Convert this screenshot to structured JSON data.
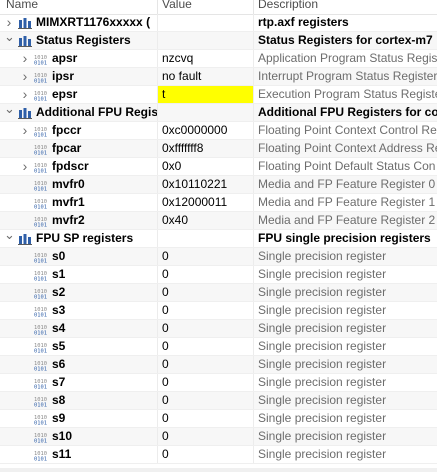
{
  "columns": {
    "name": "Name",
    "value": "Value",
    "description": "Description"
  },
  "rows": [
    {
      "indent": 0,
      "arrow": "right",
      "icon": "group",
      "name": "MIMXRT1176xxxxx (",
      "value": "",
      "description": "rtp.axf registers",
      "descBold": true
    },
    {
      "indent": 0,
      "arrow": "down",
      "icon": "group",
      "name": "Status Registers",
      "value": "",
      "description": "Status Registers for cortex-m7",
      "descBold": true
    },
    {
      "indent": 1,
      "arrow": "right",
      "icon": "reg",
      "name": "apsr",
      "value": "nzcvq",
      "description": "Application Program Status Registe",
      "descBold": false
    },
    {
      "indent": 1,
      "arrow": "right",
      "icon": "reg",
      "name": "ipsr",
      "value": "no fault",
      "description": "Interrupt Program Status Register",
      "descBold": false
    },
    {
      "indent": 1,
      "arrow": "right",
      "icon": "reg",
      "name": "epsr",
      "value": "t",
      "description": "Execution Program Status Register",
      "descBold": false,
      "highlight": true
    },
    {
      "indent": 0,
      "arrow": "down",
      "icon": "group",
      "name": "Additional FPU Regist",
      "value": "",
      "description": "Additional FPU Registers for corte",
      "descBold": true
    },
    {
      "indent": 1,
      "arrow": "right",
      "icon": "reg",
      "name": "fpccr",
      "value": "0xc0000000",
      "description": "Floating Point Context Control Re",
      "descBold": false
    },
    {
      "indent": 1,
      "arrow": "none",
      "icon": "reg",
      "name": "fpcar",
      "value": "0xfffffff8",
      "description": "Floating Point Context Address Re",
      "descBold": false
    },
    {
      "indent": 1,
      "arrow": "right",
      "icon": "reg",
      "name": "fpdscr",
      "value": "0x0",
      "description": "Floating Point Default Status Con",
      "descBold": false
    },
    {
      "indent": 1,
      "arrow": "none",
      "icon": "reg",
      "name": "mvfr0",
      "value": "0x10110221",
      "description": "Media and FP Feature Register 0",
      "descBold": false
    },
    {
      "indent": 1,
      "arrow": "none",
      "icon": "reg",
      "name": "mvfr1",
      "value": "0x12000011",
      "description": "Media and FP Feature Register 1",
      "descBold": false
    },
    {
      "indent": 1,
      "arrow": "none",
      "icon": "reg",
      "name": "mvfr2",
      "value": "0x40",
      "description": "Media and FP Feature Register 2",
      "descBold": false
    },
    {
      "indent": 0,
      "arrow": "down",
      "icon": "group",
      "name": "FPU SP registers",
      "value": "",
      "description": "FPU single precision registers",
      "descBold": true
    },
    {
      "indent": 1,
      "arrow": "none",
      "icon": "reg",
      "name": "s0",
      "value": "0",
      "description": "Single precision register",
      "descBold": false
    },
    {
      "indent": 1,
      "arrow": "none",
      "icon": "reg",
      "name": "s1",
      "value": "0",
      "description": "Single precision register",
      "descBold": false
    },
    {
      "indent": 1,
      "arrow": "none",
      "icon": "reg",
      "name": "s2",
      "value": "0",
      "description": "Single precision register",
      "descBold": false
    },
    {
      "indent": 1,
      "arrow": "none",
      "icon": "reg",
      "name": "s3",
      "value": "0",
      "description": "Single precision register",
      "descBold": false
    },
    {
      "indent": 1,
      "arrow": "none",
      "icon": "reg",
      "name": "s4",
      "value": "0",
      "description": "Single precision register",
      "descBold": false
    },
    {
      "indent": 1,
      "arrow": "none",
      "icon": "reg",
      "name": "s5",
      "value": "0",
      "description": "Single precision register",
      "descBold": false
    },
    {
      "indent": 1,
      "arrow": "none",
      "icon": "reg",
      "name": "s6",
      "value": "0",
      "description": "Single precision register",
      "descBold": false
    },
    {
      "indent": 1,
      "arrow": "none",
      "icon": "reg",
      "name": "s7",
      "value": "0",
      "description": "Single precision register",
      "descBold": false
    },
    {
      "indent": 1,
      "arrow": "none",
      "icon": "reg",
      "name": "s8",
      "value": "0",
      "description": "Single precision register",
      "descBold": false
    },
    {
      "indent": 1,
      "arrow": "none",
      "icon": "reg",
      "name": "s9",
      "value": "0",
      "description": "Single precision register",
      "descBold": false
    },
    {
      "indent": 1,
      "arrow": "none",
      "icon": "reg",
      "name": "s10",
      "value": "0",
      "description": "Single precision register",
      "descBold": false
    },
    {
      "indent": 1,
      "arrow": "none",
      "icon": "reg",
      "name": "s11",
      "value": "0",
      "description": "Single precision register",
      "descBold": false
    }
  ],
  "colors": {
    "highlight": "#ffff00",
    "iconBlue": "#2f5fa8",
    "iconGrey": "#8a8a8a"
  }
}
